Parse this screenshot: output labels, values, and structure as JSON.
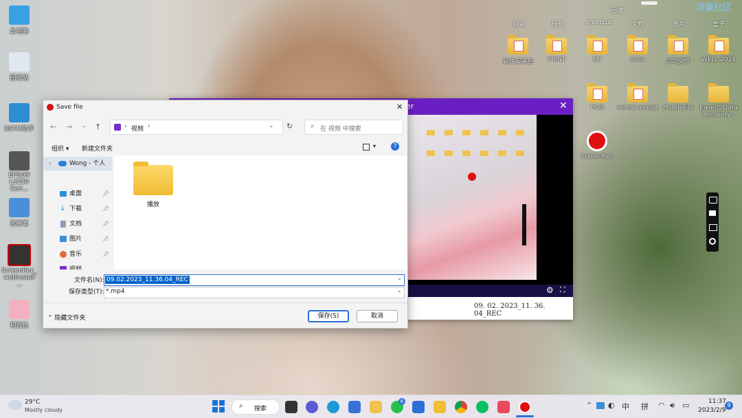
{
  "desktop_icons": [
    {
      "label": "此电脑",
      "icon": "computer-icon",
      "color": "#3aa0e6"
    },
    {
      "label": "回收站",
      "icon": "recycle-bin-icon",
      "color": "#e0e8f0"
    },
    {
      "label": "BSTM助手",
      "icon": "bstm-icon",
      "color": "#2c8fd6"
    },
    {
      "label": "EPSON L3250 Seri...",
      "icon": "printer-icon",
      "color": "#555"
    },
    {
      "label": "思维笔",
      "icon": "book-icon",
      "color": "#4a90d9"
    },
    {
      "label": "ScreenRec_ webinstall ...",
      "icon": "screenrec-installer-icon",
      "color": "#333"
    },
    {
      "label": "初音鱼",
      "icon": "anime-app-icon",
      "color": "#f3b0c0"
    }
  ],
  "right_panel": {
    "top_label": "回收",
    "corner_text": "流量社区",
    "tabs": [
      "目录",
      "压缩",
      "shortcut",
      "文档",
      "图片",
      "盒子"
    ],
    "folders_row1": [
      "软件安装包",
      "PRINT",
      "CN",
      "acca",
      "公司文件",
      "WELL 2021"
    ],
    "folders_row2": [
      "",
      "",
      "P&G",
      "rental receipt",
      "MobileFile",
      "EaseUSData Recovery..."
    ],
    "screenrec_label": "ScreenRec"
  },
  "recorder": {
    "title_fragment": "er",
    "filename_display": "09. 02. 2023_11. 36. 04_REC"
  },
  "dialog": {
    "title": "Save file",
    "breadcrumb": [
      "视频"
    ],
    "search_placeholder": "在 视频 中搜索",
    "organize": "组织",
    "new_folder": "新建文件夹",
    "tree": [
      {
        "label": "Wong - 个人",
        "icon": "cloud-icon"
      },
      {
        "label": "桌面",
        "icon": "desktop-icon"
      },
      {
        "label": "下载",
        "icon": "download-icon"
      },
      {
        "label": "文档",
        "icon": "document-icon"
      },
      {
        "label": "图片",
        "icon": "pictures-icon"
      },
      {
        "label": "音乐",
        "icon": "music-icon"
      },
      {
        "label": "视频",
        "icon": "video-icon"
      }
    ],
    "files": [
      {
        "label": "播放"
      }
    ],
    "filename_label": "文件名(N):",
    "filename_value": "09.02.2023_11.36.04_REC",
    "filetype_label": "保存类型(T):",
    "filetype_value": "*.mp4",
    "hide_folders": "隐藏文件夹",
    "save": "保存(S)",
    "cancel": "取消"
  },
  "taskbar": {
    "weather_temp": "29°C",
    "weather_desc": "Mostly cloudy",
    "search": "搜索",
    "whatsapp_badge": "6",
    "ime_lang": "中",
    "ime_mode": "拼",
    "time": "11:37",
    "date": "2023/2/9",
    "notify_badge": "9"
  },
  "colors": {
    "accent_purple": "#6a1fc2",
    "selection_blue": "#0a64c8",
    "save_blue": "#2b6fd6"
  }
}
